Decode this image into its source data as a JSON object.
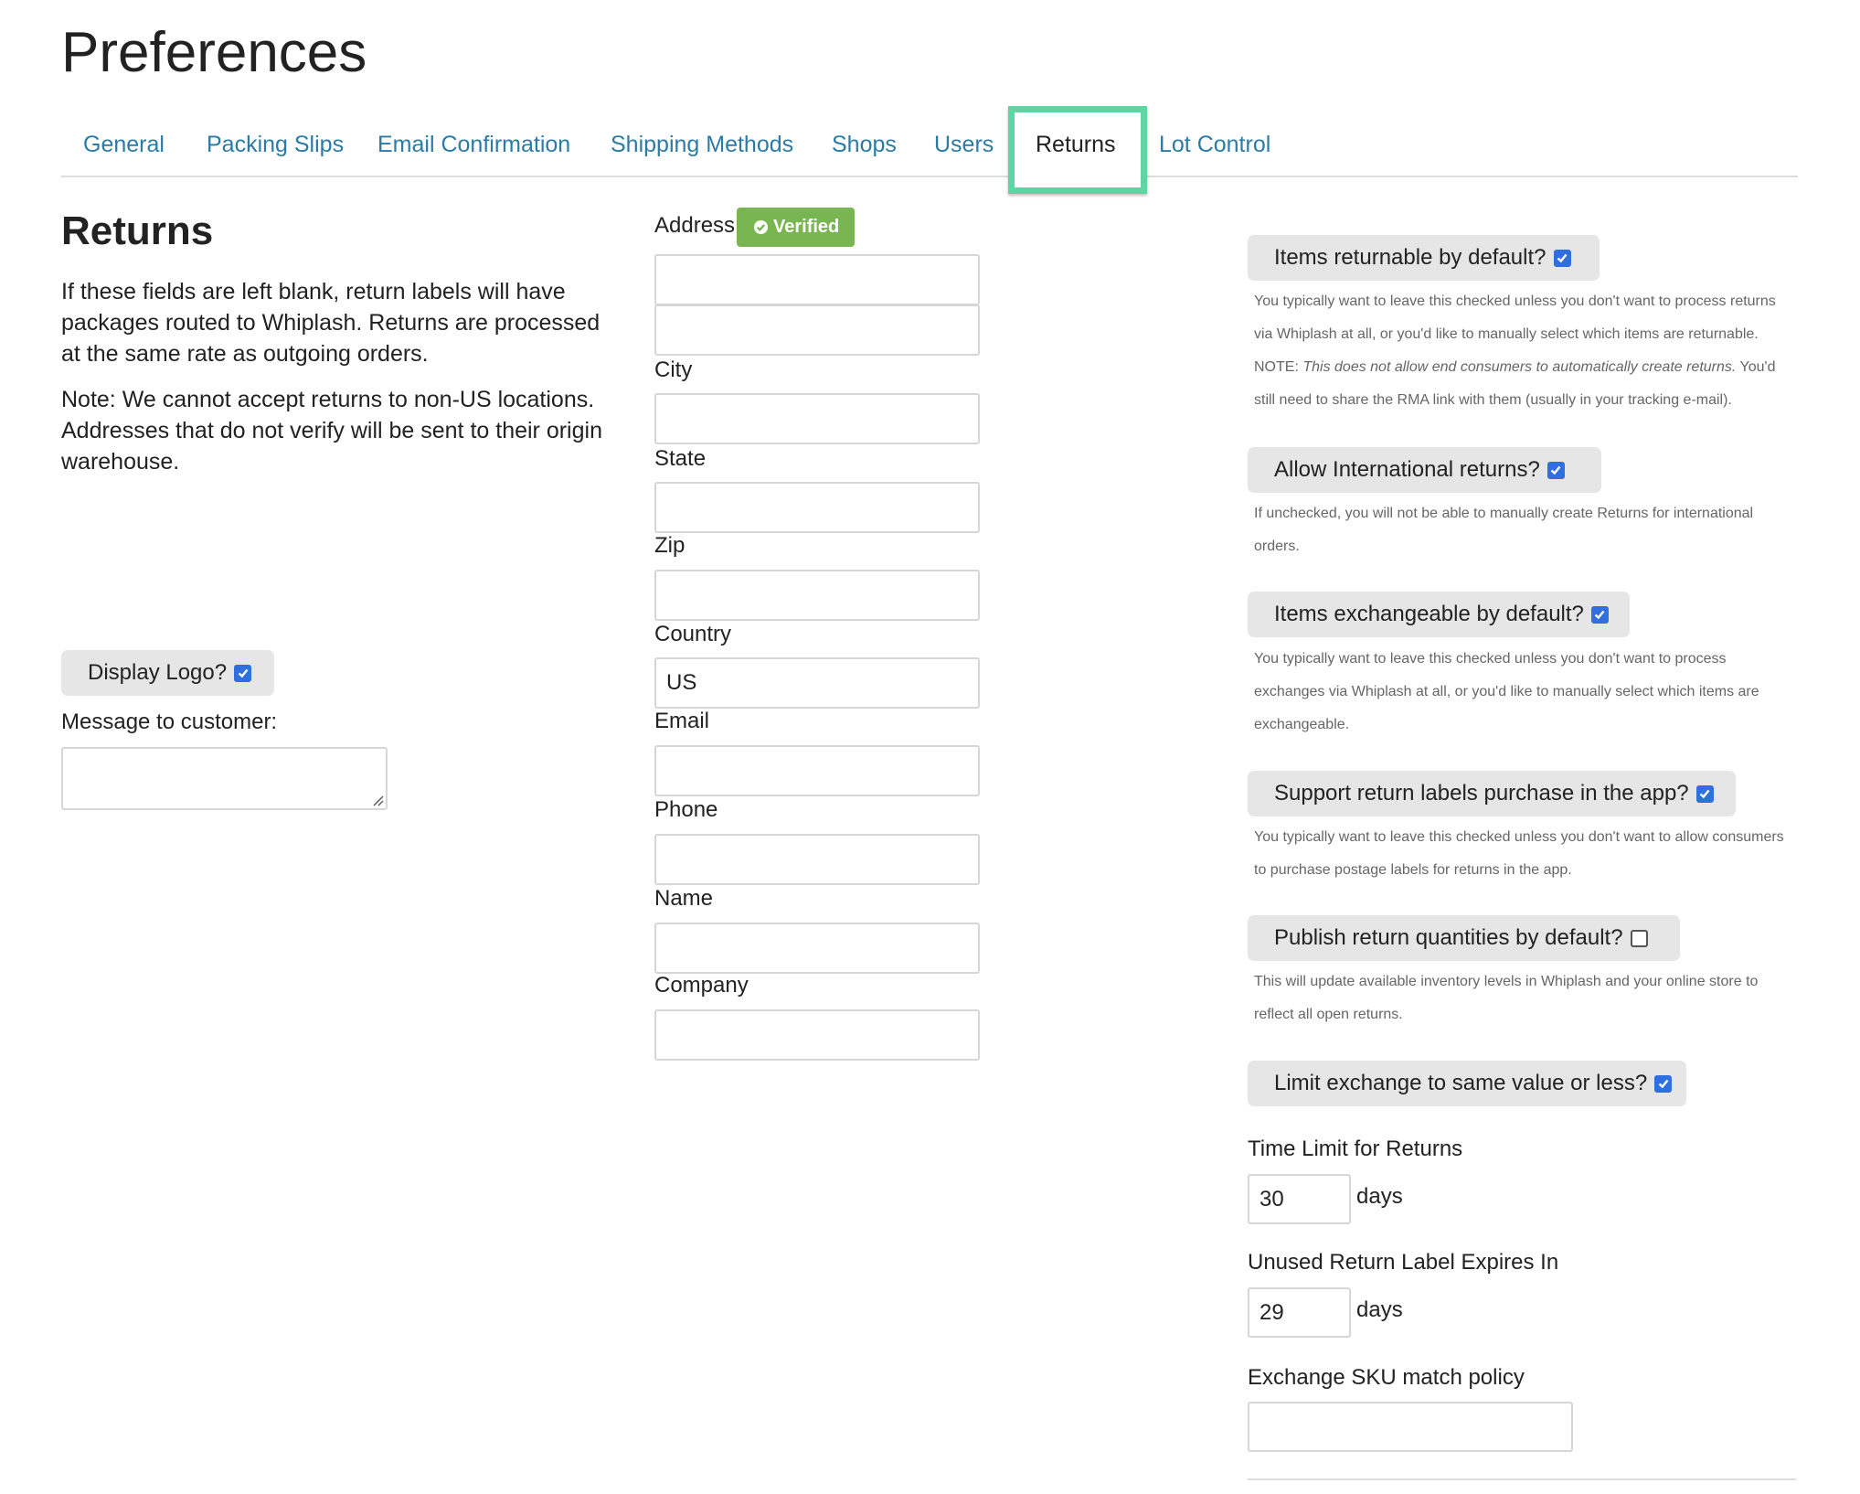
{
  "page": {
    "title": "Preferences"
  },
  "tabs": [
    {
      "label": "General"
    },
    {
      "label": "Packing Slips"
    },
    {
      "label": "Email Confirmation"
    },
    {
      "label": "Shipping Methods"
    },
    {
      "label": "Shops"
    },
    {
      "label": "Users"
    },
    {
      "label": "Returns",
      "active": true
    },
    {
      "label": "Lot Control"
    }
  ],
  "returns": {
    "title": "Returns",
    "info_1": "If these fields are left blank, return labels will have packages routed to Whiplash. Returns are processed at the same rate as outgoing orders.",
    "info_2": "Note: We cannot accept returns to non-US locations. Addresses that do not verify will be sent to their origin warehouse.",
    "display_logo": {
      "label": "Display Logo?",
      "checked": true
    },
    "message_label": "Message to customer:",
    "message_value": ""
  },
  "address": {
    "label": "Address",
    "badge": "Verified",
    "line1": "",
    "line2": "",
    "city_label": "City",
    "city": "",
    "state_label": "State",
    "state": "",
    "zip_label": "Zip",
    "zip": "",
    "country_label": "Country",
    "country": "US",
    "email_label": "Email",
    "email": "",
    "phone_label": "Phone",
    "phone": "",
    "name_label": "Name",
    "name": "",
    "company_label": "Company",
    "company": ""
  },
  "options": {
    "returnable": {
      "label": "Items returnable by default?",
      "checked": true,
      "help_1": "You typically want to leave this checked unless you don't want to process returns via Whiplash at all, or you'd like to manually select which items are returnable. NOTE: ",
      "help_em": "This does not allow end consumers to automatically create returns.",
      "help_2": " You'd still need to share the RMA link with them (usually in your tracking e-mail)."
    },
    "international": {
      "label": "Allow International returns?",
      "checked": true,
      "help": "If unchecked, you will not be able to manually create Returns for international orders."
    },
    "exchangeable": {
      "label": "Items exchangeable by default?",
      "checked": true,
      "help": "You typically want to leave this checked unless you don't want to process exchanges via Whiplash at all, or you'd like to manually select which items are exchangeable."
    },
    "labels_purchase": {
      "label": "Support return labels purchase in the app?",
      "checked": true,
      "help": "You typically want to leave this checked unless you don't want to allow consumers to purchase postage labels for returns in the app."
    },
    "publish_quantities": {
      "label": "Publish return quantities by default?",
      "checked": false,
      "help": "This will update available inventory levels in Whiplash and your online store to reflect all open returns."
    },
    "limit_exchange": {
      "label": "Limit exchange to same value or less?",
      "checked": true
    },
    "time_limit": {
      "label": "Time Limit for Returns",
      "value": "30",
      "unit": "days"
    },
    "label_expires": {
      "label": "Unused Return Label Expires In",
      "value": "29",
      "unit": "days"
    },
    "sku_policy": {
      "label": "Exchange SKU match policy",
      "value": ""
    }
  },
  "colors": {
    "link": "#2b7ba6",
    "highlight": "#5dd6a3",
    "verified": "#79b651",
    "checkbox": "#2f6fe0"
  },
  "icons": {
    "checkbox": "check-icon",
    "badge": "check-circle-icon",
    "textarea": "resize-handle-icon"
  }
}
